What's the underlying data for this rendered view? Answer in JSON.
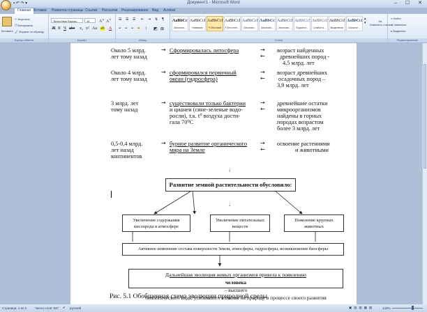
{
  "window": {
    "title": "Документ1 - Microsoft Word",
    "controls": "‒ ☐ ✕"
  },
  "ribbon": {
    "tabs": [
      "Главная",
      "Вставка",
      "Разметка страницы",
      "Ссылки",
      "Рассылки",
      "Рецензирование",
      "Вид",
      "Acrobat"
    ],
    "clipboard": {
      "paste": "Вставить",
      "cut": "Вырезать",
      "copy": "Копировать",
      "format_painter": "Формат по образцу",
      "group": "Буфер обмена"
    },
    "font": {
      "name": "Times New Roman",
      "size": "14",
      "group": "Шрифт"
    },
    "paragraph": {
      "group": "Абзац"
    },
    "styles": {
      "group": "Стили",
      "items": [
        {
          "preview": "AaBbCcI",
          "name": "Заголово..."
        },
        {
          "preview": "AaBbCcI",
          "name": "Название"
        },
        {
          "preview": "AaBbCcI",
          "name": "¶ Обычный"
        },
        {
          "preview": "AaBbCcI",
          "name": "¶ Без инте..."
        },
        {
          "preview": "AaBbCcI",
          "name": "Заголово..."
        },
        {
          "preview": "AaBbCc",
          "name": "Заголово..."
        },
        {
          "preview": "AaBbCcI",
          "name": "Заголово..."
        },
        {
          "preview": "AaBbCcI",
          "name": "Подзагол..."
        },
        {
          "preview": "AaBbCcD",
          "name": "Слабое в..."
        },
        {
          "preview": "AaBbCcD",
          "name": "Выделение"
        },
        {
          "preview": "AaBbCcD",
          "name": "Сильное ..."
        }
      ],
      "change_styles": "Изменить стили"
    },
    "editing": {
      "find": "Найти",
      "replace": "Заменить",
      "select": "Выделить",
      "group": "Редактирование"
    }
  },
  "document": {
    "rows": [
      {
        "time": [
          "Около 5 млрд.",
          "лет тому назад"
        ],
        "event": [
          "Сформировалась  литосфера"
        ],
        "result": [
          "возраст найденных",
          "древнейших пород  -",
          "4,5 млрд. лет"
        ]
      },
      {
        "time": [
          "Около 4 млрд.",
          "лет тому назад"
        ],
        "event": [
          "сформировался первичный",
          "океан (гидросфера)"
        ],
        "result": [
          "возраст древнейших",
          "осадочных пород –",
          "3,9 млрд. лет"
        ]
      },
      {
        "time": [
          "3 млрд. лет",
          "тому назад"
        ],
        "event": [
          "существовали только бактерии",
          "и цианеи (сине-зеленые водо-",
          "росли), т.к. t⁰ воздуха дости-",
          "гала 70⁰С"
        ],
        "result": [
          "древнейшие остатки",
          "микроорганизмов",
          "найдены в горных",
          "породах возрастом",
          "более 3 млрд. лет"
        ]
      },
      {
        "time": [
          "0,5-0,4 млрд.",
          "лет назад",
          "континентов"
        ],
        "event": [
          "бурное развитие органического",
          "мира на Земле"
        ],
        "result": [
          "освоение растениями",
          "и     животными"
        ]
      }
    ],
    "arrow_right": "→",
    "arrow_left": "←",
    "diagram": {
      "main": "Развитие земной растительности  обусловило:",
      "effects": [
        [
          "Увеличение содержания",
          "кислорода в атмосфере"
        ],
        [
          "Увеличение питательных",
          "веществ"
        ],
        [
          "Появление крупных",
          "животных"
        ]
      ],
      "change": "Активное изменение состава поверхности Земли, атмосферы, гидросферы, возникновение биосферы",
      "evolution_prefix": "Дальнейшая эволюция живых организмов привела  к появлению ",
      "evolution_bold": "человека",
      "evolution_suffix": " – высшего",
      "evolution_line2": "биологического вида, усилившего влияние на природу в процессе своего развития"
    },
    "caption": "Рис. 5.1 Обобщенная схема эволюции природной среды"
  },
  "status": {
    "page": "Страница: 1 из 2",
    "words": "Число слов: 937",
    "language": "русский",
    "zoom": "140%"
  }
}
